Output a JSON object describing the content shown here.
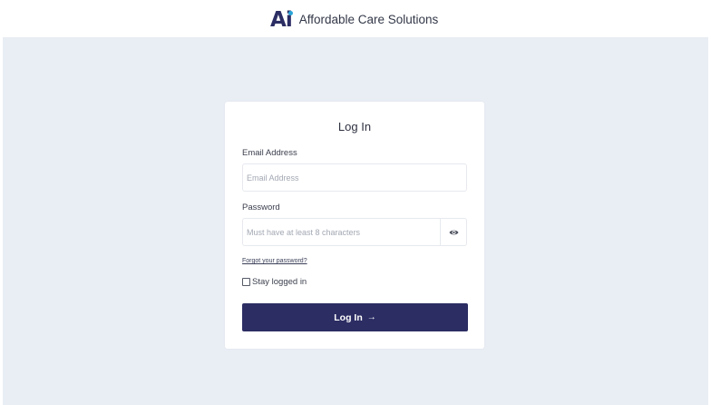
{
  "header": {
    "logo": {
      "letter_a": "A",
      "letter_i": "i"
    },
    "brand_name": "Affordable Care Solutions"
  },
  "login_card": {
    "title": "Log In",
    "email": {
      "label": "Email Address",
      "value": "",
      "placeholder": "Email Address"
    },
    "password": {
      "label": "Password",
      "value": "",
      "placeholder": "Must have at least 8 characters",
      "toggle_icon": "eye-icon"
    },
    "forgot_link": "Forgot your password?",
    "stay_logged_in": {
      "label": "Stay logged in",
      "checked": false
    },
    "submit": {
      "label": "Log In",
      "icon": "→"
    }
  },
  "colors": {
    "brand_navy": "#2c2d63",
    "brand_accent": "#2aa5d8",
    "page_background": "#e9edf4",
    "card_background": "#ffffff"
  }
}
